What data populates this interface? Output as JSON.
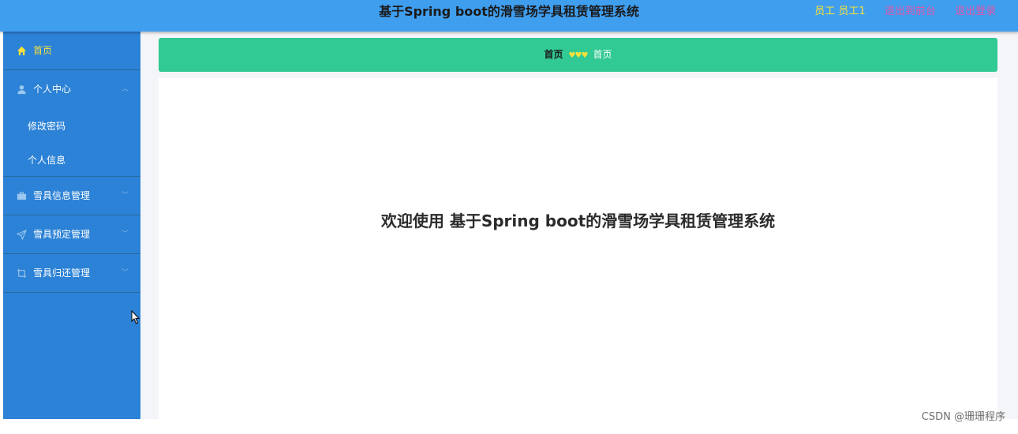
{
  "header": {
    "title": "基于Spring boot的滑雪场学具租赁管理系统",
    "user_label": "员工 员工1",
    "back_link": "退出到前台",
    "logout_link": "退出登录"
  },
  "sidebar": {
    "items": [
      {
        "label": "首页",
        "icon": "home-icon",
        "active": true
      },
      {
        "label": "个人中心",
        "icon": "user-icon",
        "expanded": true,
        "children": [
          {
            "label": "修改密码"
          },
          {
            "label": "个人信息"
          }
        ]
      },
      {
        "label": "雪具信息管理",
        "icon": "briefcase-icon"
      },
      {
        "label": "雪具预定管理",
        "icon": "send-icon"
      },
      {
        "label": "雪具归还管理",
        "icon": "crop-icon"
      }
    ]
  },
  "breadcrumb": {
    "home": "首页",
    "separator": "♥♥♥",
    "current": "首页"
  },
  "main": {
    "welcome": "欢迎使用 基于Spring boot的滑雪场学具租赁管理系统"
  },
  "watermark": "CSDN @珊珊程序",
  "colors": {
    "header_bg": "#409eef",
    "sidebar_bg": "#2c82d6",
    "breadcrumb_bg": "#31c994",
    "active_text": "#f7e13a",
    "link_text": "#e054a4"
  }
}
